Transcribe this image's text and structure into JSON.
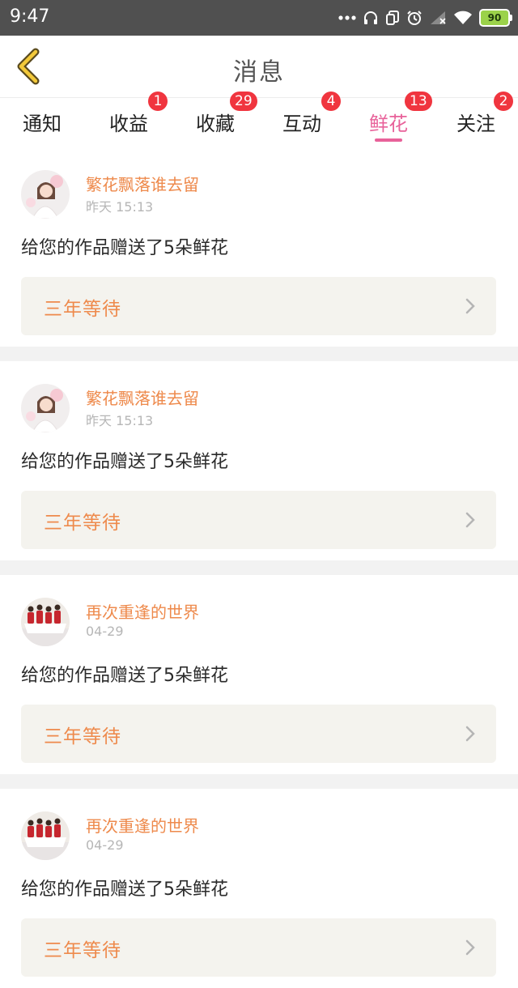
{
  "status_bar": {
    "time": "9:47",
    "battery": "90",
    "icons": [
      "more-dots-icon",
      "headset-icon",
      "copy-icon",
      "alarm-icon",
      "signal-icon",
      "wifi-icon",
      "battery-icon"
    ]
  },
  "header": {
    "title": "消息",
    "back_icon": "chevron-left-icon"
  },
  "tabs": [
    {
      "label": "通知",
      "badge": ""
    },
    {
      "label": "收益",
      "badge": "1"
    },
    {
      "label": "收藏",
      "badge": "29"
    },
    {
      "label": "互动",
      "badge": "4"
    },
    {
      "label": "鲜花",
      "badge": "13",
      "active": true
    },
    {
      "label": "关注",
      "badge": "2"
    }
  ],
  "messages": [
    {
      "user": "繁花飘落谁去留",
      "time": "昨天 15:13",
      "text": "给您的作品赠送了5朵鲜花",
      "work": "三年等待"
    },
    {
      "user": "繁花飘落谁去留",
      "time": "昨天 15:13",
      "text": "给您的作品赠送了5朵鲜花",
      "work": "三年等待"
    },
    {
      "user": "再次重逢的世界",
      "time": "04-29",
      "text": "给您的作品赠送了5朵鲜花",
      "work": "三年等待"
    },
    {
      "user": "再次重逢的世界",
      "time": "04-29",
      "text": "给您的作品赠送了5朵鲜花",
      "work": "三年等待"
    }
  ],
  "colors": {
    "accent_pink": "#e8629a",
    "name_orange": "#ee8a4c",
    "badge_red": "#f0353f",
    "box_bg": "#f4f3ee",
    "status_bar": "#505050"
  }
}
